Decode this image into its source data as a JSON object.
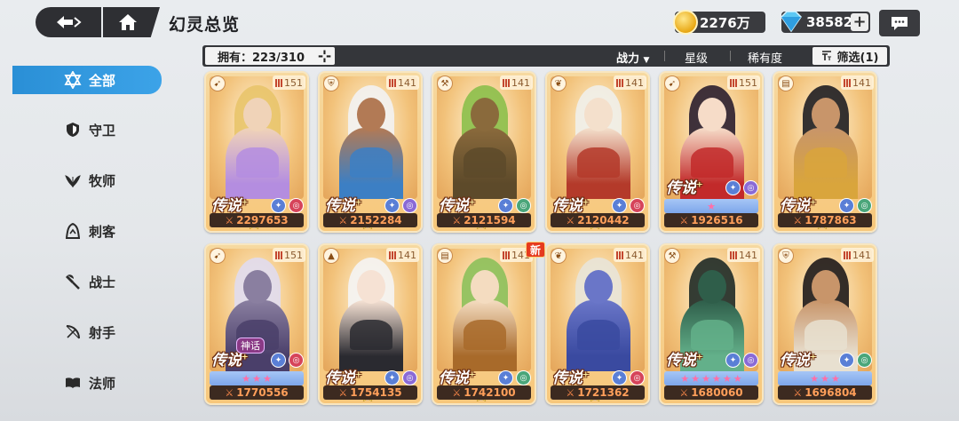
{
  "header": {
    "title": "幻灵总览",
    "gold": "2276万",
    "gems": "38582"
  },
  "sidebar": {
    "items": [
      {
        "label": "全部",
        "icon": "star-of-david-icon",
        "active": true
      },
      {
        "label": "守卫",
        "icon": "shield-icon",
        "active": false
      },
      {
        "label": "牧师",
        "icon": "leaf-icon",
        "active": false
      },
      {
        "label": "刺客",
        "icon": "hood-icon",
        "active": false
      },
      {
        "label": "战士",
        "icon": "axe-icon",
        "active": false
      },
      {
        "label": "射手",
        "icon": "bow-icon",
        "active": false
      },
      {
        "label": "法师",
        "icon": "book-icon",
        "active": false
      }
    ]
  },
  "filterbar": {
    "owned_label": "拥有：223/310",
    "sort_power": "战力",
    "sort_stars": "星级",
    "sort_rarity": "稀有度",
    "filter_label": "筛选(1)"
  },
  "cards": [
    {
      "power": "2297653",
      "level": "151",
      "rarity": "传说",
      "class": "bow",
      "stars": 0,
      "palette": [
        "#f0d3b8",
        "#e8c46a",
        "#b48de0"
      ]
    },
    {
      "power": "2152284",
      "level": "141",
      "rarity": "传说",
      "class": "shield",
      "stars": 0,
      "palette": [
        "#b27a55",
        "#f2f2f2",
        "#3c7fc4"
      ]
    },
    {
      "power": "2121594",
      "level": "141",
      "rarity": "传说",
      "class": "axe",
      "stars": 0,
      "palette": [
        "#8a6a3c",
        "#8bbf4a",
        "#5d4a2a"
      ]
    },
    {
      "power": "2120442",
      "level": "141",
      "rarity": "传说",
      "class": "leaf",
      "stars": 0,
      "palette": [
        "#f4e0cc",
        "#f0f0ea",
        "#b43a2a"
      ]
    },
    {
      "power": "1926516",
      "level": "151",
      "rarity": "传说",
      "class": "bow",
      "stars": 1,
      "palette": [
        "#f6dcc8",
        "#2a1e2e",
        "#c22a2a"
      ]
    },
    {
      "power": "1787863",
      "level": "141",
      "rarity": "传说",
      "class": "book",
      "stars": 0,
      "palette": [
        "#c8956a",
        "#1e1e22",
        "#d9a53c"
      ]
    },
    {
      "power": "1770556",
      "level": "151",
      "rarity": "传说",
      "class": "bow",
      "stars": 3,
      "palette": [
        "#8a7fa0",
        "#e0dcee",
        "#4a3f6a"
      ],
      "myth": "神话"
    },
    {
      "power": "1754135",
      "level": "141",
      "rarity": "传说",
      "class": "hood",
      "stars": 0,
      "palette": [
        "#f6e2d4",
        "#f4f4f4",
        "#2a2a30"
      ]
    },
    {
      "power": "1742100",
      "level": "141",
      "rarity": "传说",
      "class": "book",
      "stars": 0,
      "palette": [
        "#f4dcc0",
        "#8cc05a",
        "#a86a2a"
      ],
      "new": "新"
    },
    {
      "power": "1721362",
      "level": "141",
      "rarity": "传说",
      "class": "leaf",
      "stars": 0,
      "palette": [
        "#6a76c8",
        "#e8e4d8",
        "#3a4aa0"
      ]
    },
    {
      "power": "1680060",
      "level": "141",
      "rarity": "传说",
      "class": "axe",
      "stars": 6,
      "palette": [
        "#2f5e4a",
        "#1e2a26",
        "#63b08a"
      ]
    },
    {
      "power": "1696804",
      "level": "141",
      "rarity": "传说",
      "class": "shield",
      "stars": 3,
      "palette": [
        "#c8956a",
        "#1e1a1a",
        "#e8e0d0"
      ]
    }
  ]
}
